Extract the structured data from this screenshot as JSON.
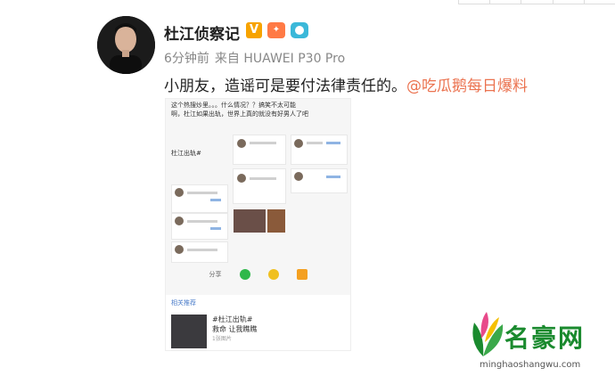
{
  "post": {
    "username": "杜江侦察记",
    "badge_v": "V",
    "time": "6分钟前",
    "source": "来自 HUAWEI P30 Pro",
    "text": "小朋友，造谣可是要付法律责任的。",
    "mention": "@吃瓜鹅每日爆料"
  },
  "screenshot": {
    "line1": "这个热搜炒里。。。什么情况？？搞笑不太可能",
    "line2": "啊，杜江如果出轨，世界上真的就没有好男人了吧",
    "tag": "杜江出轨#",
    "share_label": "分享",
    "related_title": "相关推荐",
    "related_tag": "#杜江出轨#",
    "related_line": "救命 让我瞧瞧",
    "related_meta": "1张图片"
  },
  "watermark": {
    "name": "名豪网",
    "url": "minghaoshangwu.com",
    "colors": {
      "green": "#1a8a2e",
      "leaf_pink": "#e84a8a",
      "leaf_yellow": "#f5c000"
    }
  }
}
